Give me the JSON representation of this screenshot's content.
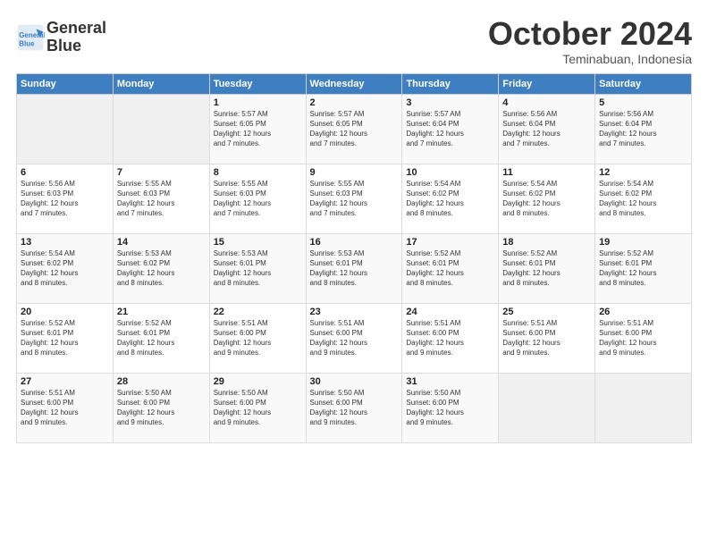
{
  "logo": {
    "line1": "General",
    "line2": "Blue"
  },
  "title": "October 2024",
  "subtitle": "Teminabuan, Indonesia",
  "days_header": [
    "Sunday",
    "Monday",
    "Tuesday",
    "Wednesday",
    "Thursday",
    "Friday",
    "Saturday"
  ],
  "weeks": [
    [
      {
        "day": "",
        "info": ""
      },
      {
        "day": "",
        "info": ""
      },
      {
        "day": "1",
        "info": "Sunrise: 5:57 AM\nSunset: 6:05 PM\nDaylight: 12 hours\nand 7 minutes."
      },
      {
        "day": "2",
        "info": "Sunrise: 5:57 AM\nSunset: 6:05 PM\nDaylight: 12 hours\nand 7 minutes."
      },
      {
        "day": "3",
        "info": "Sunrise: 5:57 AM\nSunset: 6:04 PM\nDaylight: 12 hours\nand 7 minutes."
      },
      {
        "day": "4",
        "info": "Sunrise: 5:56 AM\nSunset: 6:04 PM\nDaylight: 12 hours\nand 7 minutes."
      },
      {
        "day": "5",
        "info": "Sunrise: 5:56 AM\nSunset: 6:04 PM\nDaylight: 12 hours\nand 7 minutes."
      }
    ],
    [
      {
        "day": "6",
        "info": "Sunrise: 5:56 AM\nSunset: 6:03 PM\nDaylight: 12 hours\nand 7 minutes."
      },
      {
        "day": "7",
        "info": "Sunrise: 5:55 AM\nSunset: 6:03 PM\nDaylight: 12 hours\nand 7 minutes."
      },
      {
        "day": "8",
        "info": "Sunrise: 5:55 AM\nSunset: 6:03 PM\nDaylight: 12 hours\nand 7 minutes."
      },
      {
        "day": "9",
        "info": "Sunrise: 5:55 AM\nSunset: 6:03 PM\nDaylight: 12 hours\nand 7 minutes."
      },
      {
        "day": "10",
        "info": "Sunrise: 5:54 AM\nSunset: 6:02 PM\nDaylight: 12 hours\nand 8 minutes."
      },
      {
        "day": "11",
        "info": "Sunrise: 5:54 AM\nSunset: 6:02 PM\nDaylight: 12 hours\nand 8 minutes."
      },
      {
        "day": "12",
        "info": "Sunrise: 5:54 AM\nSunset: 6:02 PM\nDaylight: 12 hours\nand 8 minutes."
      }
    ],
    [
      {
        "day": "13",
        "info": "Sunrise: 5:54 AM\nSunset: 6:02 PM\nDaylight: 12 hours\nand 8 minutes."
      },
      {
        "day": "14",
        "info": "Sunrise: 5:53 AM\nSunset: 6:02 PM\nDaylight: 12 hours\nand 8 minutes."
      },
      {
        "day": "15",
        "info": "Sunrise: 5:53 AM\nSunset: 6:01 PM\nDaylight: 12 hours\nand 8 minutes."
      },
      {
        "day": "16",
        "info": "Sunrise: 5:53 AM\nSunset: 6:01 PM\nDaylight: 12 hours\nand 8 minutes."
      },
      {
        "day": "17",
        "info": "Sunrise: 5:52 AM\nSunset: 6:01 PM\nDaylight: 12 hours\nand 8 minutes."
      },
      {
        "day": "18",
        "info": "Sunrise: 5:52 AM\nSunset: 6:01 PM\nDaylight: 12 hours\nand 8 minutes."
      },
      {
        "day": "19",
        "info": "Sunrise: 5:52 AM\nSunset: 6:01 PM\nDaylight: 12 hours\nand 8 minutes."
      }
    ],
    [
      {
        "day": "20",
        "info": "Sunrise: 5:52 AM\nSunset: 6:01 PM\nDaylight: 12 hours\nand 8 minutes."
      },
      {
        "day": "21",
        "info": "Sunrise: 5:52 AM\nSunset: 6:01 PM\nDaylight: 12 hours\nand 8 minutes."
      },
      {
        "day": "22",
        "info": "Sunrise: 5:51 AM\nSunset: 6:00 PM\nDaylight: 12 hours\nand 9 minutes."
      },
      {
        "day": "23",
        "info": "Sunrise: 5:51 AM\nSunset: 6:00 PM\nDaylight: 12 hours\nand 9 minutes."
      },
      {
        "day": "24",
        "info": "Sunrise: 5:51 AM\nSunset: 6:00 PM\nDaylight: 12 hours\nand 9 minutes."
      },
      {
        "day": "25",
        "info": "Sunrise: 5:51 AM\nSunset: 6:00 PM\nDaylight: 12 hours\nand 9 minutes."
      },
      {
        "day": "26",
        "info": "Sunrise: 5:51 AM\nSunset: 6:00 PM\nDaylight: 12 hours\nand 9 minutes."
      }
    ],
    [
      {
        "day": "27",
        "info": "Sunrise: 5:51 AM\nSunset: 6:00 PM\nDaylight: 12 hours\nand 9 minutes."
      },
      {
        "day": "28",
        "info": "Sunrise: 5:50 AM\nSunset: 6:00 PM\nDaylight: 12 hours\nand 9 minutes."
      },
      {
        "day": "29",
        "info": "Sunrise: 5:50 AM\nSunset: 6:00 PM\nDaylight: 12 hours\nand 9 minutes."
      },
      {
        "day": "30",
        "info": "Sunrise: 5:50 AM\nSunset: 6:00 PM\nDaylight: 12 hours\nand 9 minutes."
      },
      {
        "day": "31",
        "info": "Sunrise: 5:50 AM\nSunset: 6:00 PM\nDaylight: 12 hours\nand 9 minutes."
      },
      {
        "day": "",
        "info": ""
      },
      {
        "day": "",
        "info": ""
      }
    ]
  ]
}
